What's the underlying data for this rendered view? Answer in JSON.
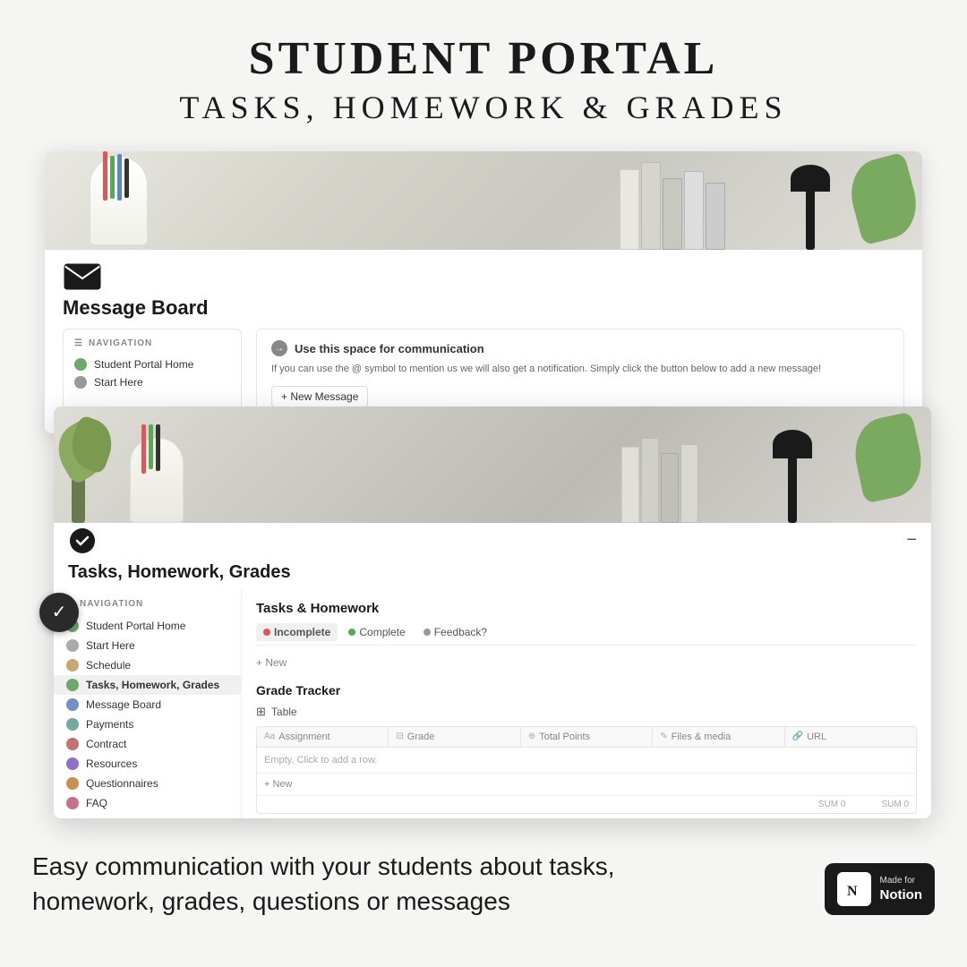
{
  "header": {
    "title": "STUDENT PORTAL",
    "subtitle": "TASKS, HOMEWORK & GRADES"
  },
  "card1": {
    "title": "Message Board",
    "nav": {
      "label": "NAVIGATION",
      "items": [
        {
          "label": "Student Portal Home",
          "icon": "green"
        },
        {
          "label": "Start Here",
          "icon": "gray"
        }
      ]
    },
    "message": {
      "header": "Use this space for communication",
      "body": "If you can use the @ symbol to mention us we will also get a notification. Simply click the button below to add a new message!",
      "button": "+ New Message"
    }
  },
  "card2": {
    "title": "Tasks, Homework, Grades",
    "nav": {
      "label": "NAVIGATION",
      "items": [
        {
          "label": "Student Portal Home",
          "icon": "green",
          "active": false
        },
        {
          "label": "Start Here",
          "icon": "gray",
          "active": false
        },
        {
          "label": "Schedule",
          "icon": "brown",
          "active": false
        },
        {
          "label": "Tasks, Homework, Grades",
          "icon": "green",
          "active": true
        },
        {
          "label": "Message Board",
          "icon": "blue",
          "active": false
        },
        {
          "label": "Payments",
          "icon": "teal",
          "active": false
        },
        {
          "label": "Contract",
          "icon": "red",
          "active": false
        },
        {
          "label": "Resources",
          "icon": "purple",
          "active": false
        },
        {
          "label": "Questionnaires",
          "icon": "orange",
          "active": false
        },
        {
          "label": "FAQ",
          "icon": "pink",
          "active": false
        }
      ]
    },
    "main": {
      "tasks_section": "Tasks & Homework",
      "tabs": [
        {
          "label": "Incomplete",
          "color": "red",
          "active": true
        },
        {
          "label": "Complete",
          "color": "green",
          "active": false
        },
        {
          "label": "Feedback?",
          "color": "gray",
          "active": false
        }
      ],
      "new_label": "+ New",
      "grade_tracker": "Grade Tracker",
      "table_label": "Table",
      "table_headers": [
        "Assignment",
        "Grade",
        "Total Points",
        "Files & media",
        "URL"
      ],
      "empty_row": "Empty. Click to add a row.",
      "add_row": "+ New",
      "sum_labels": [
        "SUM 0",
        "SUM 0"
      ]
    }
  },
  "bottom": {
    "text": "Easy communication with your students about tasks,\nhomework, grades, questions or messages",
    "made_for_notion": "Made for",
    "notion": "Notion"
  }
}
